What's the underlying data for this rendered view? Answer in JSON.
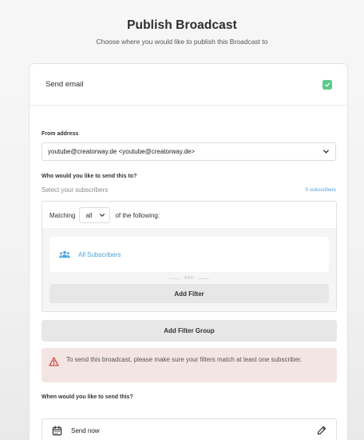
{
  "page": {
    "title": "Publish Broadcast",
    "subtitle": "Choose where you would like to publish this Broadcast to"
  },
  "email_section": {
    "label": "Send email",
    "checked": true,
    "accent_color": "#5cc98b"
  },
  "from_address": {
    "label": "From address",
    "value": "youtube@creatorway.de <youtube@creatorway.de>",
    "icon": "chevron-down-icon"
  },
  "recipients": {
    "question": "Who would you like to send this to?",
    "select_label": "Select your subscribers",
    "subscriber_count": "0 subscribers",
    "link_color": "#4aa3df"
  },
  "filters": {
    "matching_prefix": "Matching",
    "matching_value": "all",
    "matching_suffix": "of the following:",
    "items": [
      {
        "label": "All Subscribers",
        "icon": "users-icon"
      }
    ],
    "and_label": "AND",
    "add_filter_label": "Add Filter",
    "add_filter_group_label": "Add Filter Group"
  },
  "warning": {
    "icon": "warning-triangle-icon",
    "text": "To send this broadcast, please make sure your filters match at least one subscriber.",
    "color": "#d34a3c"
  },
  "schedule": {
    "question": "When would you like to send this?",
    "option_label": "Send now",
    "option_icon": "calendar-icon",
    "edit_icon": "pencil-icon"
  }
}
